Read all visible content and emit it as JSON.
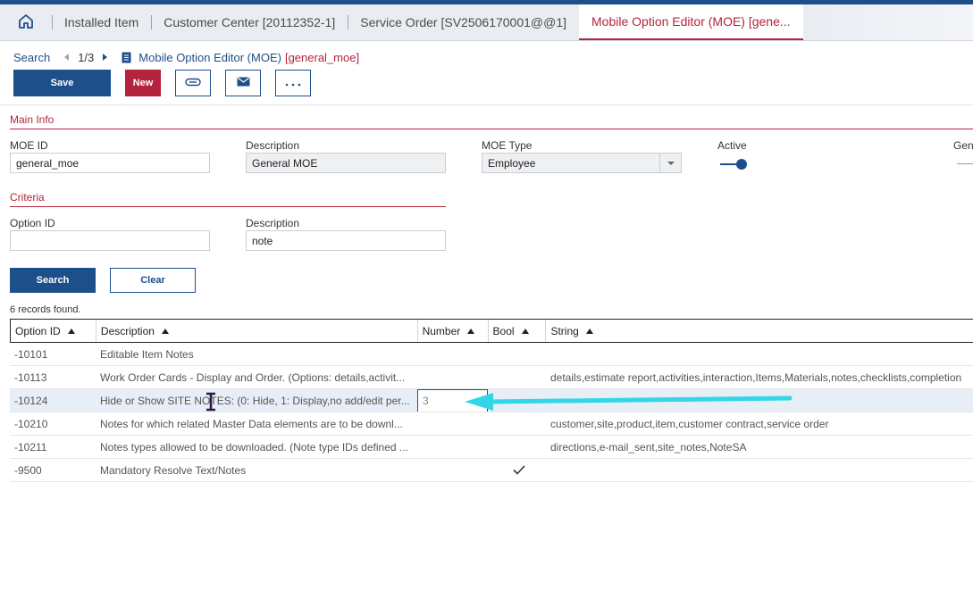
{
  "tabs": {
    "home_icon": "home-icon",
    "items": [
      {
        "label": "Installed Item"
      },
      {
        "label": "Customer Center [20112352-1]"
      },
      {
        "label": "Service Order [SV2506170001@@1]"
      },
      {
        "label": "Mobile Option Editor (MOE) [gene..."
      }
    ],
    "active_index": 3
  },
  "breadcrumb": {
    "search": "Search",
    "pager": "1/3",
    "title": "Mobile Option Editor (MOE)",
    "record": "[general_moe]"
  },
  "toolbar": {
    "save_label": "Save",
    "new_label": "New",
    "attach_icon": "paperclip-icon",
    "email_icon": "envelope-icon",
    "more_icon": "ellipsis-icon"
  },
  "main_info": {
    "title": "Main Info",
    "moe_id_label": "MOE ID",
    "moe_id_value": "general_moe",
    "description_label": "Description",
    "description_value": "General MOE",
    "moe_type_label": "MOE Type",
    "moe_type_value": "Employee",
    "active_label": "Active",
    "active_value": true,
    "clipped_label": "Gen"
  },
  "criteria": {
    "title": "Criteria",
    "option_id_label": "Option ID",
    "option_id_value": "",
    "description_label": "Description",
    "description_value": "note",
    "search_label": "Search",
    "clear_label": "Clear"
  },
  "results": {
    "count_text": "6 records found.",
    "columns": [
      "Option ID",
      "Description",
      "Number",
      "Bool",
      "String"
    ],
    "rows": [
      {
        "id": "-10101",
        "description": "Editable Item Notes",
        "number": "",
        "bool": false,
        "string": ""
      },
      {
        "id": "-10113",
        "description": "Work Order Cards - Display and Order. (Options: details,activit...",
        "number": "",
        "bool": false,
        "string": "details,estimate report,activities,interaction,Items,Materials,notes,checklists,completion"
      },
      {
        "id": "-10124",
        "description": "Hide or Show SITE NOTES: (0: Hide, 1: Display,no add/edit per...",
        "number": "3",
        "bool": false,
        "string": ""
      },
      {
        "id": "-10210",
        "description": "Notes for which related Master Data elements are to be downl...",
        "number": "",
        "bool": false,
        "string": "customer,site,product,item,customer contract,service order"
      },
      {
        "id": "-10211",
        "description": "Notes types allowed to be downloaded. (Note type IDs defined ...",
        "number": "",
        "bool": false,
        "string": "directions,e-mail_sent,site_notes,NoteSA"
      },
      {
        "id": "-9500",
        "description": "Mandatory Resolve Text/Notes",
        "number": "",
        "bool": true,
        "string": ""
      }
    ],
    "selected_row": 2
  },
  "colors": {
    "brand_blue": "#1d4f8b",
    "accent_red": "#b4243d",
    "annotation_cyan": "#33d6e6"
  }
}
